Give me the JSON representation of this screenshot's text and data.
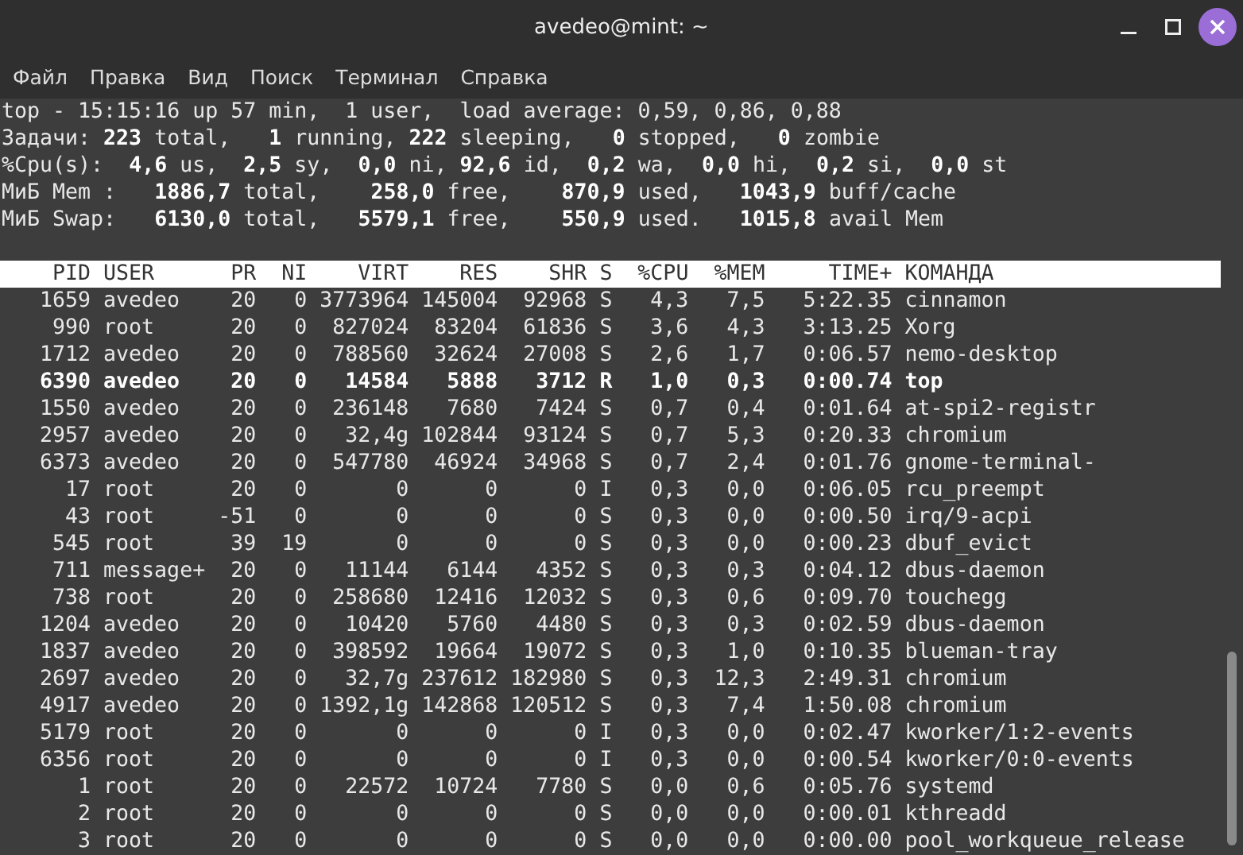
{
  "window": {
    "title": "avedeo@mint: ~"
  },
  "menu": [
    "Файл",
    "Правка",
    "Вид",
    "Поиск",
    "Терминал",
    "Справка"
  ],
  "summary": [
    "top - 15:15:16 up 57 min,  1 user,  load average: 0,59, 0,86, 0,88",
    "Задачи: **223** total,   **1** running, **222** sleeping,   **0** stopped,   **0** zombie",
    "%Cpu(s):  **4,6** us,  **2,5** sy,  **0,0** ni, **92,6** id,  **0,2** wa,  **0,0** hi,  **0,2** si,  **0,0** st",
    "МиБ Mem :   **1886,7** total,    **258,0** free,    **870,9** used,   **1043,9** buff/cache",
    "МиБ Swap:   **6130,0** total,   **5579,1** free,    **550,9** used.   **1015,8** avail Mem"
  ],
  "table": {
    "columns": [
      "PID",
      "USER",
      "PR",
      "NI",
      "VIRT",
      "RES",
      "SHR",
      "S",
      "%CPU",
      "%MEM",
      "TIME+",
      "КОМАНДА"
    ],
    "rows": [
      {
        "highlighted": false,
        "cells": [
          "1659",
          "avedeo",
          "20",
          "0",
          "3773964",
          "145004",
          "92968",
          "S",
          "4,3",
          "7,5",
          "5:22.35",
          "cinnamon"
        ]
      },
      {
        "highlighted": false,
        "cells": [
          "990",
          "root",
          "20",
          "0",
          "827024",
          "83204",
          "61836",
          "S",
          "3,6",
          "4,3",
          "3:13.25",
          "Xorg"
        ]
      },
      {
        "highlighted": false,
        "cells": [
          "1712",
          "avedeo",
          "20",
          "0",
          "788560",
          "32624",
          "27008",
          "S",
          "2,6",
          "1,7",
          "0:06.57",
          "nemo-desktop"
        ]
      },
      {
        "highlighted": true,
        "cells": [
          "6390",
          "avedeo",
          "20",
          "0",
          "14584",
          "5888",
          "3712",
          "R",
          "1,0",
          "0,3",
          "0:00.74",
          "top"
        ]
      },
      {
        "highlighted": false,
        "cells": [
          "1550",
          "avedeo",
          "20",
          "0",
          "236148",
          "7680",
          "7424",
          "S",
          "0,7",
          "0,4",
          "0:01.64",
          "at-spi2-registr"
        ]
      },
      {
        "highlighted": false,
        "cells": [
          "2957",
          "avedeo",
          "20",
          "0",
          "32,4g",
          "102844",
          "93124",
          "S",
          "0,7",
          "5,3",
          "0:20.33",
          "chromium"
        ]
      },
      {
        "highlighted": false,
        "cells": [
          "6373",
          "avedeo",
          "20",
          "0",
          "547780",
          "46924",
          "34968",
          "S",
          "0,7",
          "2,4",
          "0:01.76",
          "gnome-terminal-"
        ]
      },
      {
        "highlighted": false,
        "cells": [
          "17",
          "root",
          "20",
          "0",
          "0",
          "0",
          "0",
          "I",
          "0,3",
          "0,0",
          "0:06.05",
          "rcu_preempt"
        ]
      },
      {
        "highlighted": false,
        "cells": [
          "43",
          "root",
          "-51",
          "0",
          "0",
          "0",
          "0",
          "S",
          "0,3",
          "0,0",
          "0:00.50",
          "irq/9-acpi"
        ]
      },
      {
        "highlighted": false,
        "cells": [
          "545",
          "root",
          "39",
          "19",
          "0",
          "0",
          "0",
          "S",
          "0,3",
          "0,0",
          "0:00.23",
          "dbuf_evict"
        ]
      },
      {
        "highlighted": false,
        "cells": [
          "711",
          "message+",
          "20",
          "0",
          "11144",
          "6144",
          "4352",
          "S",
          "0,3",
          "0,3",
          "0:04.12",
          "dbus-daemon"
        ]
      },
      {
        "highlighted": false,
        "cells": [
          "738",
          "root",
          "20",
          "0",
          "258680",
          "12416",
          "12032",
          "S",
          "0,3",
          "0,6",
          "0:09.70",
          "touchegg"
        ]
      },
      {
        "highlighted": false,
        "cells": [
          "1204",
          "avedeo",
          "20",
          "0",
          "10420",
          "5760",
          "4480",
          "S",
          "0,3",
          "0,3",
          "0:02.59",
          "dbus-daemon"
        ]
      },
      {
        "highlighted": false,
        "cells": [
          "1837",
          "avedeo",
          "20",
          "0",
          "398592",
          "19664",
          "19072",
          "S",
          "0,3",
          "1,0",
          "0:10.35",
          "blueman-tray"
        ]
      },
      {
        "highlighted": false,
        "cells": [
          "2697",
          "avedeo",
          "20",
          "0",
          "32,7g",
          "237612",
          "182980",
          "S",
          "0,3",
          "12,3",
          "2:49.31",
          "chromium"
        ]
      },
      {
        "highlighted": false,
        "cells": [
          "4917",
          "avedeo",
          "20",
          "0",
          "1392,1g",
          "142868",
          "120512",
          "S",
          "0,3",
          "7,4",
          "1:50.08",
          "chromium"
        ]
      },
      {
        "highlighted": false,
        "cells": [
          "5179",
          "root",
          "20",
          "0",
          "0",
          "0",
          "0",
          "I",
          "0,3",
          "0,0",
          "0:02.47",
          "kworker/1:2-events"
        ]
      },
      {
        "highlighted": false,
        "cells": [
          "6356",
          "root",
          "20",
          "0",
          "0",
          "0",
          "0",
          "I",
          "0,3",
          "0,0",
          "0:00.54",
          "kworker/0:0-events"
        ]
      },
      {
        "highlighted": false,
        "cells": [
          "1",
          "root",
          "20",
          "0",
          "22572",
          "10724",
          "7780",
          "S",
          "0,0",
          "0,6",
          "0:05.76",
          "systemd"
        ]
      },
      {
        "highlighted": false,
        "cells": [
          "2",
          "root",
          "20",
          "0",
          "0",
          "0",
          "0",
          "S",
          "0,0",
          "0,0",
          "0:00.01",
          "kthreadd"
        ]
      },
      {
        "highlighted": false,
        "cells": [
          "3",
          "root",
          "20",
          "0",
          "0",
          "0",
          "0",
          "S",
          "0,0",
          "0,0",
          "0:00.00",
          "pool_workqueue_release"
        ]
      }
    ]
  }
}
